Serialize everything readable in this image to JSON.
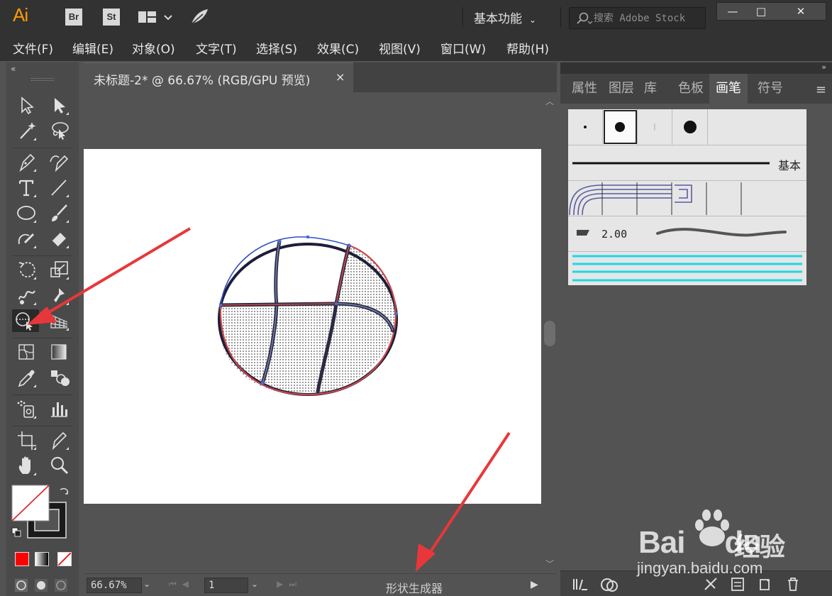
{
  "app": {
    "logo": "Ai",
    "bridge": "Br",
    "stock": "St",
    "workspace": "基本功能",
    "search_placeholder": "搜索 Adobe Stock",
    "layout_icon": "layout-icon",
    "feather_icon": "feather-icon"
  },
  "window": {
    "minimize": "—",
    "maximize": "□",
    "close": "✕"
  },
  "menu": [
    "文件(F)",
    "编辑(E)",
    "对象(O)",
    "文字(T)",
    "选择(S)",
    "效果(C)",
    "视图(V)",
    "窗口(W)",
    "帮助(H)"
  ],
  "document": {
    "tab_title": "未标题-2* @ 66.67% (RGB/GPU 预览)",
    "close": "×"
  },
  "statusbar": {
    "zoom": "66.67%",
    "page": "1",
    "current_tool": "形状生成器"
  },
  "panel": {
    "tabs": [
      "属性",
      "图层",
      "库",
      "色板",
      "画笔",
      "符号"
    ],
    "active_tab": "画笔",
    "basic_brush_label": "基本",
    "art_brush_size": "2.00"
  },
  "tools": [
    "selection-tool",
    "direct-selection-tool",
    "magic-wand-tool",
    "lasso-tool",
    "pen-tool",
    "curvature-tool",
    "type-tool",
    "line-tool",
    "ellipse-tool",
    "paintbrush-tool",
    "shaper-tool",
    "eraser-tool",
    "rotate-tool",
    "scale-tool",
    "warp-tool",
    "puppet-warp-tool",
    "shape-builder-tool",
    "perspective-grid-tool",
    "mesh-tool",
    "gradient-tool",
    "eyedropper-tool",
    "blend-tool",
    "symbol-sprayer-tool",
    "column-graph-tool",
    "artboard-tool",
    "slice-tool",
    "hand-tool",
    "zoom-tool"
  ],
  "colors": {
    "accent": "#ff9a00",
    "arrow": "#e8373a",
    "fill_swatch": "#ff0000",
    "stroke_swatch": "#000000"
  },
  "watermark": {
    "brand": "Bai",
    "brand_tail": "du",
    "cn": "经验",
    "url": "jingyan.baidu.com"
  }
}
